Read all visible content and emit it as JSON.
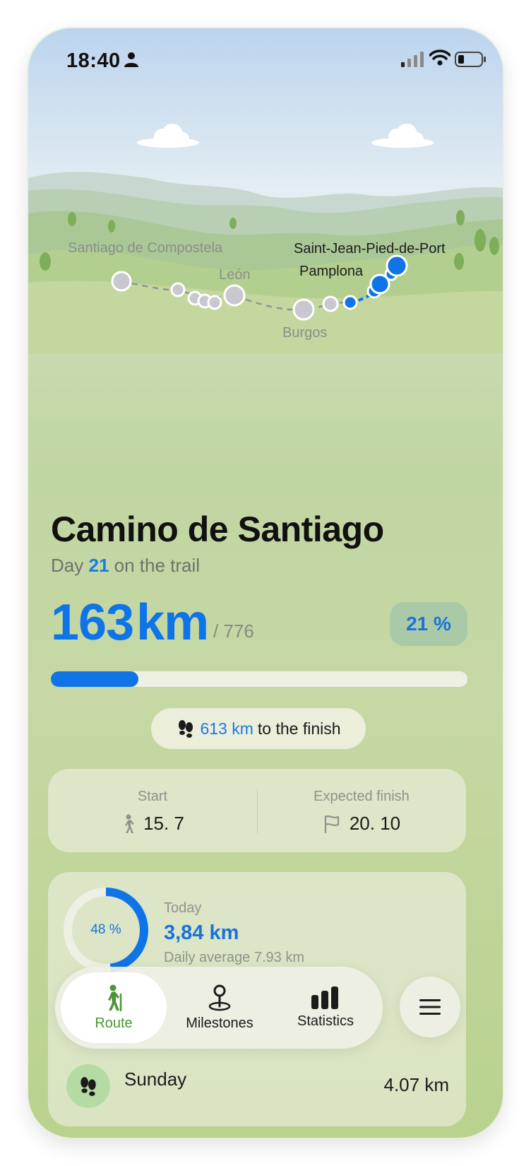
{
  "status_bar": {
    "time": "18:40"
  },
  "route_map": {
    "towns": [
      {
        "name": "Santiago de Compostela",
        "reached": false
      },
      {
        "name": "León",
        "reached": false
      },
      {
        "name": "Burgos",
        "reached": false
      },
      {
        "name": "Pamplona",
        "reached": true
      },
      {
        "name": "Saint-Jean-Pied-de-Port",
        "reached": true
      }
    ]
  },
  "journey": {
    "title": "Camino de Santiago",
    "day_prefix": "Day",
    "day_number": "21",
    "day_suffix": "on the trail",
    "walked_km": "163",
    "unit": "km",
    "total_label": "/ 776",
    "percent_label": "21 %",
    "progress_fraction": 0.21,
    "remaining_km": "613 km",
    "remaining_suffix": "to the finish"
  },
  "dates": {
    "start_label": "Start",
    "start_value": "15. 7",
    "finish_label": "Expected finish",
    "finish_value": "20. 10"
  },
  "today": {
    "percent_label": "48 %",
    "progress_fraction": 0.48,
    "label": "Today",
    "km": "3,84 km",
    "daily_average": "Daily average 7.93 km"
  },
  "history": [
    {
      "day": "Sunday",
      "km": "4.07 km"
    }
  ],
  "tabbar": {
    "tabs": [
      {
        "label": "Route",
        "icon": "hiker-icon",
        "active": true
      },
      {
        "label": "Milestones",
        "icon": "pin-icon",
        "active": false
      },
      {
        "label": "Statistics",
        "icon": "bar-chart-icon",
        "active": false
      }
    ],
    "menu_icon": "hamburger-icon"
  },
  "colors": {
    "accent": "#0f74e8",
    "active_tab": "#4a9634",
    "muted": "#8f938b"
  }
}
